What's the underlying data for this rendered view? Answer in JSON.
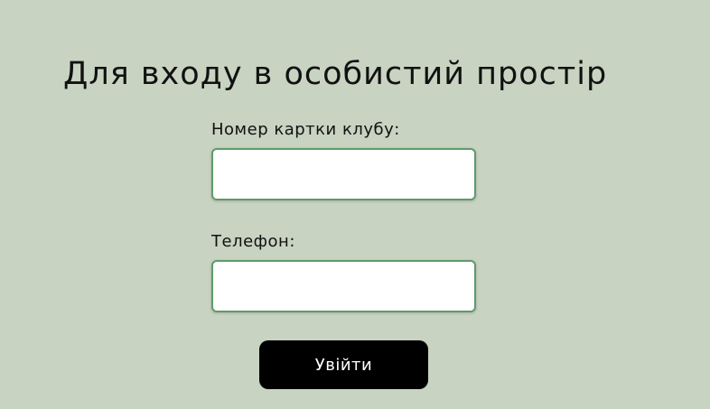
{
  "page": {
    "title": "Для входу в особистий простір"
  },
  "form": {
    "card_label": "Номер картки клубу:",
    "card_value": "",
    "phone_label": "Телефон:",
    "phone_value": "",
    "submit_label": "Увійти"
  },
  "colors": {
    "background": "#c8d3c2",
    "input_border": "#5f9a6a",
    "button_background": "#000000",
    "button_text": "#ffffff"
  }
}
